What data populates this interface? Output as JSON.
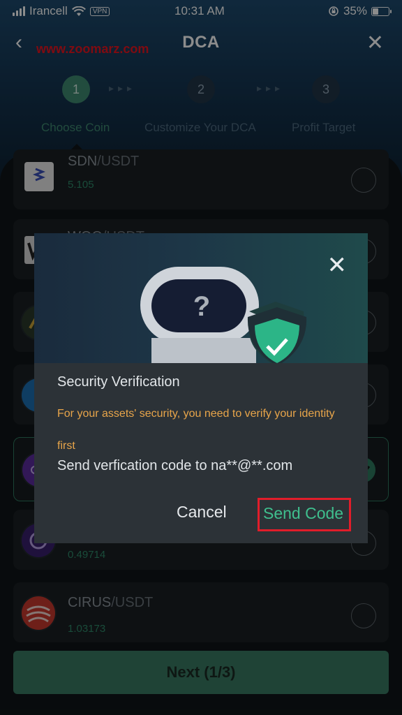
{
  "status_bar": {
    "carrier": "Irancell",
    "vpn": "VPN",
    "time": "10:31 AM",
    "battery": "35%"
  },
  "nav": {
    "title": "DCA",
    "watermark": "www.zoomarz.com"
  },
  "stepper": {
    "steps": [
      {
        "number": "1",
        "label": "Choose Coin",
        "active": true
      },
      {
        "number": "2",
        "label": "Customize Your DCA",
        "active": false
      },
      {
        "number": "3",
        "label": "Profit Target",
        "active": false
      }
    ]
  },
  "coins": [
    {
      "symbol": "SDN",
      "quote": "/USDT",
      "price": "5.105",
      "logo_text": "SHIDEN"
    },
    {
      "symbol": "WOO",
      "quote": "/USDT",
      "price": "",
      "logo_text": ""
    },
    {
      "symbol": "",
      "quote": "",
      "price": "",
      "logo_text": ""
    },
    {
      "symbol": "",
      "quote": "",
      "price": "",
      "logo_text": ""
    },
    {
      "symbol": "",
      "quote": "",
      "price": "",
      "logo_text": ""
    },
    {
      "symbol": "",
      "quote": "",
      "price": "0.49714",
      "logo_text": ""
    },
    {
      "symbol": "CIRUS",
      "quote": "/USDT",
      "price": "1.03173",
      "logo_text": ""
    }
  ],
  "next_button": "Next (1/3)",
  "modal": {
    "title": "Security Verification",
    "warning": "For your assets' security, you need to verify your identity first",
    "send_to": "Send verfication code to na**@**.com",
    "cancel": "Cancel",
    "send_code": "Send Code",
    "hero_glyph": "?"
  },
  "colors": {
    "accent": "#3f8a71",
    "warning": "#e8a54a",
    "highlight": "#e11d2a"
  }
}
